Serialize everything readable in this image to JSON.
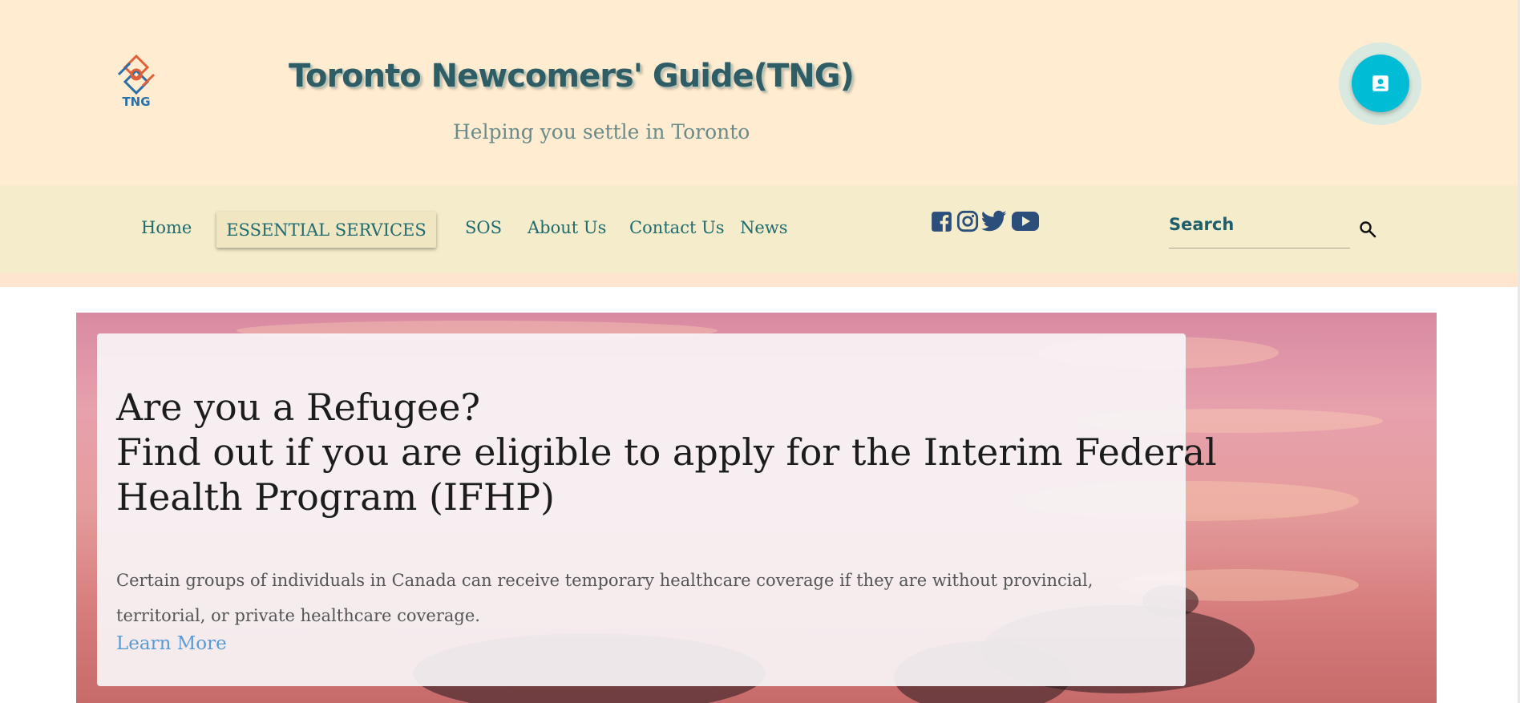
{
  "header": {
    "logo_text": "TNG",
    "title": "Toronto Newcomers' Guide(TNG)",
    "subtitle": "Helping you settle in Toronto"
  },
  "nav": {
    "items": [
      {
        "label": "Home"
      },
      {
        "label": "ESSENTIAL SERVICES"
      },
      {
        "label": "SOS"
      },
      {
        "label": "About Us"
      },
      {
        "label": "Contact Us"
      },
      {
        "label": "News"
      }
    ],
    "active": "ESSENTIAL SERVICES"
  },
  "social": {
    "icons": [
      "facebook-icon",
      "instagram-icon",
      "twitter-icon",
      "youtube-icon"
    ],
    "color": "#2c4e7a"
  },
  "search": {
    "label": "Search"
  },
  "hero": {
    "title_line1": "Are you a Refugee?",
    "title_line2": "Find out if you are eligible to apply for the Interim Federal",
    "title_line3": "Health Program (IFHP)",
    "body_line1": "Certain groups of individuals in Canada can receive temporary healthcare coverage if they are without provincial,",
    "body_line2": "territorial, or private healthcare coverage.",
    "link": "Learn More"
  },
  "colors": {
    "header_bg": "#ffecd1",
    "nav_bg": "#f4ecca",
    "accent": "#00bcd4",
    "nav_text": "#1f6b6f",
    "link": "#5a9bd4"
  }
}
